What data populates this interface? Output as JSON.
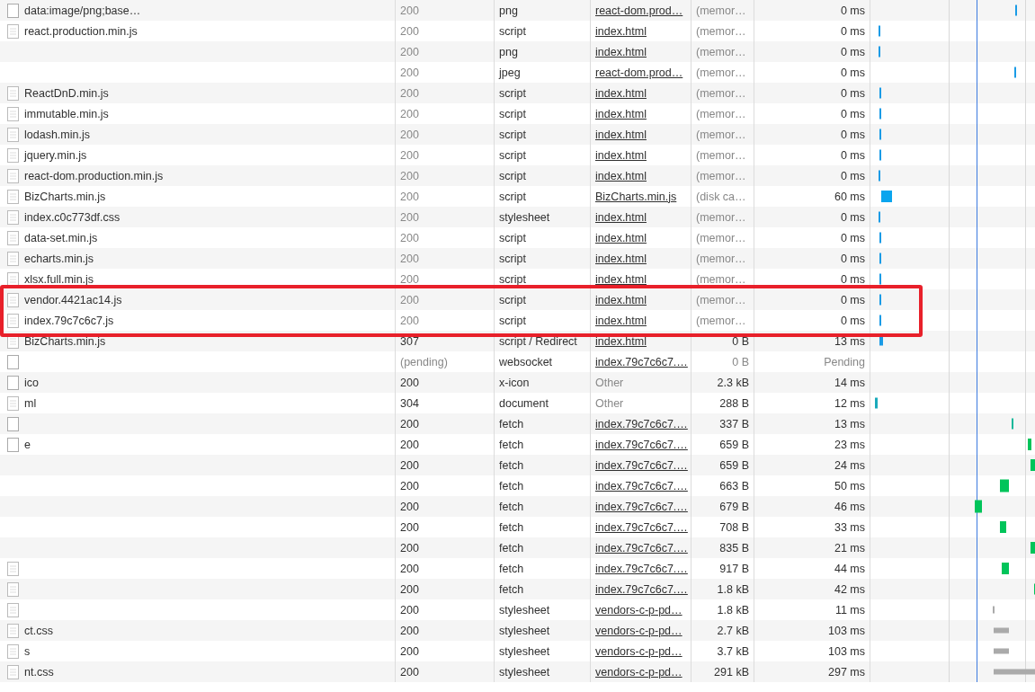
{
  "rows": [
    {
      "name": "data:image/png;base…",
      "kind": "blank",
      "status": "200",
      "dimmed": true,
      "type": "png",
      "initiator": "react-dom.prod…",
      "initiator_link": true,
      "size": "(memor…",
      "time": "0 ms",
      "highlighted": false
    },
    {
      "name": "react.production.min.js",
      "kind": "file",
      "status": "200",
      "dimmed": true,
      "type": "script",
      "initiator": "index.html",
      "initiator_link": true,
      "size": "(memor…",
      "time": "0 ms",
      "highlighted": false
    },
    {
      "kind": "none",
      "status": "200",
      "dimmed": true,
      "type": "png",
      "initiator": "index.html",
      "initiator_link": true,
      "size": "(memor…",
      "time": "0 ms",
      "highlighted": false
    },
    {
      "kind": "none",
      "status": "200",
      "dimmed": true,
      "type": "jpeg",
      "initiator": "react-dom.prod…",
      "initiator_link": true,
      "size": "(memor…",
      "time": "0 ms",
      "highlighted": false
    },
    {
      "name": "ReactDnD.min.js",
      "kind": "file",
      "status": "200",
      "dimmed": true,
      "type": "script",
      "initiator": "index.html",
      "initiator_link": true,
      "size": "(memor…",
      "time": "0 ms",
      "highlighted": false
    },
    {
      "name": "immutable.min.js",
      "kind": "file",
      "status": "200",
      "dimmed": true,
      "type": "script",
      "initiator": "index.html",
      "initiator_link": true,
      "size": "(memor…",
      "time": "0 ms",
      "highlighted": false
    },
    {
      "name": "lodash.min.js",
      "kind": "file",
      "status": "200",
      "dimmed": true,
      "type": "script",
      "initiator": "index.html",
      "initiator_link": true,
      "size": "(memor…",
      "time": "0 ms",
      "highlighted": false
    },
    {
      "name": "jquery.min.js",
      "kind": "file",
      "status": "200",
      "dimmed": true,
      "type": "script",
      "initiator": "index.html",
      "initiator_link": true,
      "size": "(memor…",
      "time": "0 ms",
      "highlighted": false
    },
    {
      "name": "react-dom.production.min.js",
      "kind": "file",
      "status": "200",
      "dimmed": true,
      "type": "script",
      "initiator": "index.html",
      "initiator_link": true,
      "size": "(memor…",
      "time": "0 ms",
      "highlighted": false
    },
    {
      "name": "BizCharts.min.js",
      "kind": "file",
      "status": "200",
      "dimmed": true,
      "type": "script",
      "initiator": "BizCharts.min.js",
      "initiator_link": true,
      "size": "(disk ca…",
      "time": "60 ms",
      "highlighted": false
    },
    {
      "name": "index.c0c773df.css",
      "kind": "file",
      "status": "200",
      "dimmed": true,
      "type": "stylesheet",
      "initiator": "index.html",
      "initiator_link": true,
      "size": "(memor…",
      "time": "0 ms",
      "highlighted": false
    },
    {
      "name": "data-set.min.js",
      "kind": "file",
      "status": "200",
      "dimmed": true,
      "type": "script",
      "initiator": "index.html",
      "initiator_link": true,
      "size": "(memor…",
      "time": "0 ms",
      "highlighted": false
    },
    {
      "name": "echarts.min.js",
      "kind": "file",
      "status": "200",
      "dimmed": true,
      "type": "script",
      "initiator": "index.html",
      "initiator_link": true,
      "size": "(memor…",
      "time": "0 ms",
      "highlighted": false
    },
    {
      "name": "xlsx.full.min.js",
      "kind": "file",
      "status": "200",
      "dimmed": true,
      "type": "script",
      "initiator": "index.html",
      "initiator_link": true,
      "size": "(memor…",
      "time": "0 ms",
      "highlighted": false
    },
    {
      "name": "vendor.4421ac14.js",
      "kind": "file",
      "status": "200",
      "dimmed": true,
      "type": "script",
      "initiator": "index.html",
      "initiator_link": true,
      "size": "(memor…",
      "time": "0 ms",
      "highlighted": true
    },
    {
      "name": "index.79c7c6c7.js",
      "kind": "file",
      "status": "200",
      "dimmed": true,
      "type": "script",
      "initiator": "index.html",
      "initiator_link": true,
      "size": "(memor…",
      "time": "0 ms",
      "highlighted": true
    },
    {
      "name": "BizCharts.min.js",
      "kind": "file",
      "status": "307",
      "dimmed": false,
      "type": "script / Redirect",
      "initiator": "index.html",
      "initiator_link": true,
      "size": "0 B",
      "time": "13 ms",
      "highlighted": false
    },
    {
      "kind": "blank",
      "status": "(pending)",
      "dimmed": true,
      "type": "websocket",
      "initiator": "index.79c7c6c7.…",
      "initiator_link": true,
      "size": "0 B",
      "time": "Pending",
      "highlighted": false
    },
    {
      "name": "ico",
      "kind": "blank",
      "status": "200",
      "dimmed": false,
      "type": "x-icon",
      "initiator": "Other",
      "initiator_link": false,
      "size": "2.3 kB",
      "time": "14 ms",
      "highlighted": false
    },
    {
      "name": "ml",
      "kind": "file",
      "status": "304",
      "dimmed": false,
      "type": "document",
      "initiator": "Other",
      "initiator_link": false,
      "size": "288 B",
      "time": "12 ms",
      "highlighted": false
    },
    {
      "kind": "blank",
      "status": "200",
      "dimmed": false,
      "type": "fetch",
      "initiator": "index.79c7c6c7.…",
      "initiator_link": true,
      "size": "337 B",
      "time": "13 ms",
      "highlighted": false
    },
    {
      "name": "e",
      "kind": "blank",
      "status": "200",
      "dimmed": false,
      "type": "fetch",
      "initiator": "index.79c7c6c7.…",
      "initiator_link": true,
      "size": "659 B",
      "time": "23 ms",
      "highlighted": false
    },
    {
      "kind": "none",
      "status": "200",
      "dimmed": false,
      "type": "fetch",
      "initiator": "index.79c7c6c7.…",
      "initiator_link": true,
      "size": "659 B",
      "time": "24 ms",
      "highlighted": false
    },
    {
      "kind": "none",
      "status": "200",
      "dimmed": false,
      "type": "fetch",
      "initiator": "index.79c7c6c7.…",
      "initiator_link": true,
      "size": "663 B",
      "time": "50 ms",
      "highlighted": false
    },
    {
      "kind": "none",
      "status": "200",
      "dimmed": false,
      "type": "fetch",
      "initiator": "index.79c7c6c7.…",
      "initiator_link": true,
      "size": "679 B",
      "time": "46 ms",
      "highlighted": false
    },
    {
      "kind": "none",
      "status": "200",
      "dimmed": false,
      "type": "fetch",
      "initiator": "index.79c7c6c7.…",
      "initiator_link": true,
      "size": "708 B",
      "time": "33 ms",
      "highlighted": false
    },
    {
      "kind": "none",
      "status": "200",
      "dimmed": false,
      "type": "fetch",
      "initiator": "index.79c7c6c7.…",
      "initiator_link": true,
      "size": "835 B",
      "time": "21 ms",
      "highlighted": false
    },
    {
      "kind": "file",
      "status": "200",
      "dimmed": false,
      "type": "fetch",
      "initiator": "index.79c7c6c7.…",
      "initiator_link": true,
      "size": "917 B",
      "time": "44 ms",
      "highlighted": false
    },
    {
      "kind": "file",
      "status": "200",
      "dimmed": false,
      "type": "fetch",
      "initiator": "index.79c7c6c7.…",
      "initiator_link": true,
      "size": "1.8 kB",
      "time": "42 ms",
      "highlighted": false
    },
    {
      "kind": "file",
      "status": "200",
      "dimmed": false,
      "type": "stylesheet",
      "initiator": "vendors-c-p-pd…",
      "initiator_link": true,
      "size": "1.8 kB",
      "time": "11 ms",
      "highlighted": false
    },
    {
      "name": "ct.css",
      "kind": "file",
      "status": "200",
      "dimmed": false,
      "type": "stylesheet",
      "initiator": "vendors-c-p-pd…",
      "initiator_link": true,
      "size": "2.7 kB",
      "time": "103 ms",
      "highlighted": false
    },
    {
      "name": "s",
      "kind": "file",
      "status": "200",
      "dimmed": false,
      "type": "stylesheet",
      "initiator": "vendors-c-p-pd…",
      "initiator_link": true,
      "size": "3.7 kB",
      "time": "103 ms",
      "highlighted": false
    },
    {
      "name": "nt.css",
      "kind": "file",
      "status": "200",
      "dimmed": false,
      "type": "stylesheet",
      "initiator": "vendors-c-p-pd…",
      "initiator_link": true,
      "size": "291 kB",
      "time": "297 ms",
      "highlighted": false
    }
  ]
}
